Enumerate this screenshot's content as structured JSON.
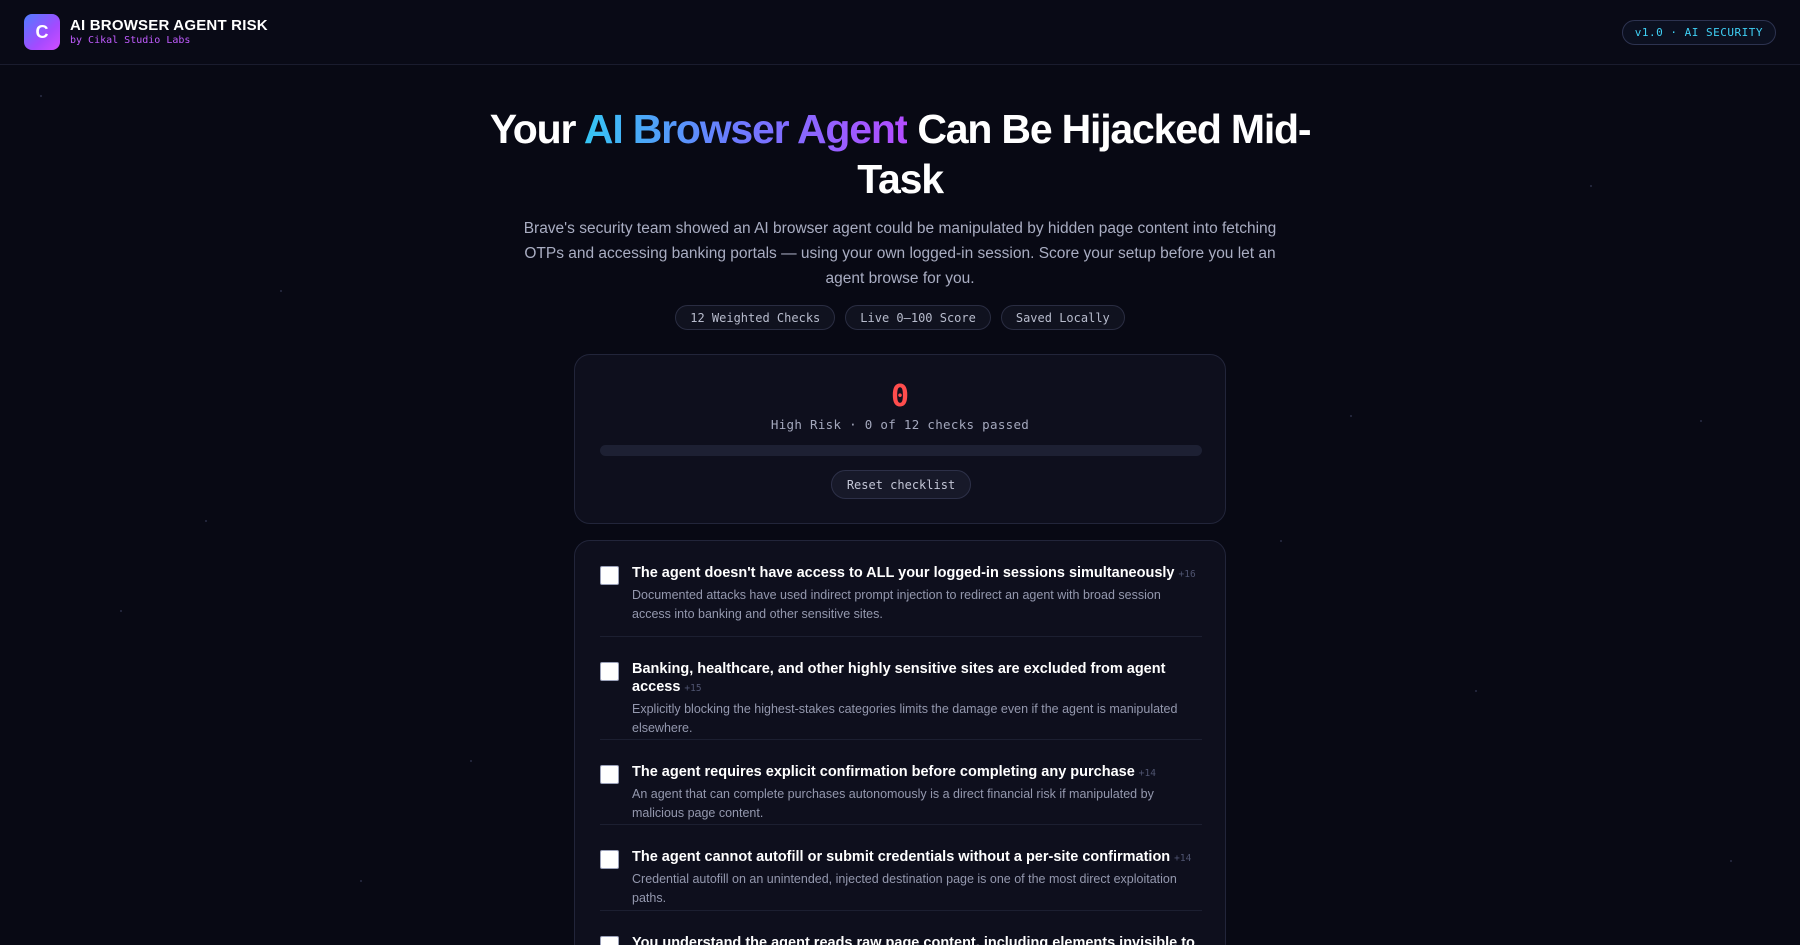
{
  "header": {
    "logo_letter": "C",
    "title": "AI BROWSER AGENT RISK",
    "subtitle": "by Cikal Studio Labs",
    "version": "v1.0 · AI SECURITY"
  },
  "hero": {
    "title_before": "Your ",
    "title_highlight": "AI Browser Agent",
    "title_after": " Can Be Hijacked Mid-Task",
    "description": "Brave's security team showed an AI browser agent could be manipulated by hidden page content into fetching OTPs and accessing banking portals — using your own logged-in session. Score your setup before you let an agent browse for you.",
    "chips": [
      "12 Weighted Checks",
      "Live 0–100 Score",
      "Saved Locally"
    ]
  },
  "score": {
    "value": "0",
    "status": "High Risk · 0 of 12 checks passed",
    "progress_fraction": 0,
    "reset_label": "Reset checklist",
    "color": "#ff4d4d"
  },
  "checklist": [
    {
      "title": "The agent doesn't have access to ALL your logged-in sessions simultaneously",
      "weight": "+16",
      "description": "Documented attacks have used indirect prompt injection to redirect an agent with broad session access into banking and other sensitive sites."
    },
    {
      "title": "Banking, healthcare, and other highly sensitive sites are excluded from agent access",
      "weight": "+15",
      "description": "Explicitly blocking the highest-stakes categories limits the damage even if the agent is manipulated elsewhere."
    },
    {
      "title": "The agent requires explicit confirmation before completing any purchase",
      "weight": "+14",
      "description": "An agent that can complete purchases autonomously is a direct financial risk if manipulated by malicious page content."
    },
    {
      "title": "The agent cannot autofill or submit credentials without a per-site confirmation",
      "weight": "+14",
      "description": "Credential autofill on an unintended, injected destination page is one of the most direct exploitation paths."
    },
    {
      "title": "You understand the agent reads raw page content, including elements invisible to",
      "weight": "",
      "description": ""
    }
  ],
  "colors": {
    "accent_cyan": "#35c6f4",
    "accent_purple": "#b44cff",
    "risk_red": "#ff4d4d",
    "background": "#080914"
  }
}
